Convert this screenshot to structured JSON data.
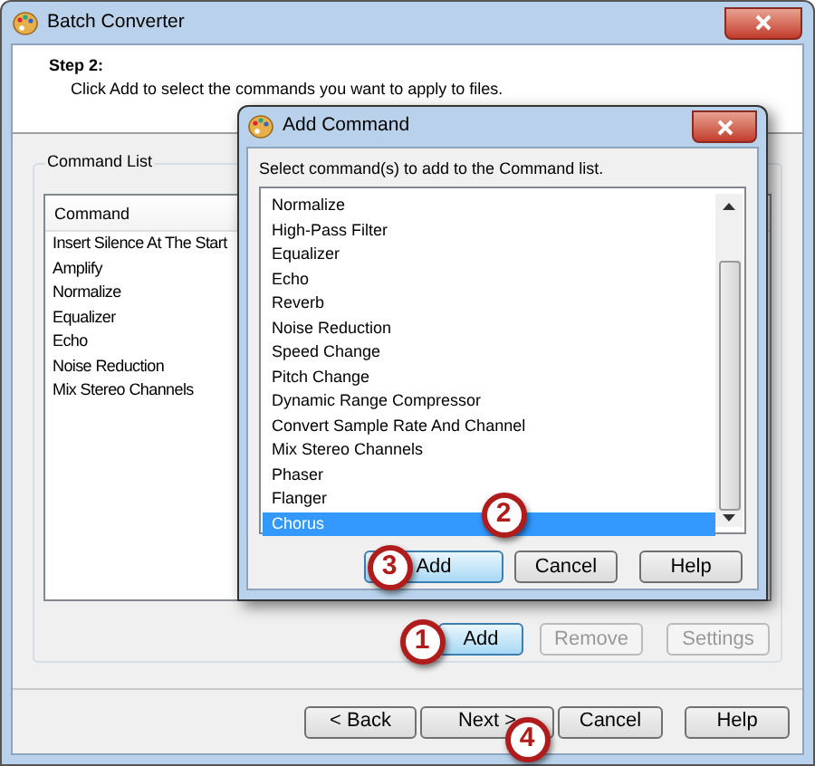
{
  "window": {
    "title": "Batch Converter"
  },
  "step": {
    "heading": "Step 2:",
    "text": "Click Add to select the commands you want to apply to files."
  },
  "command_list": {
    "label": "Command List",
    "column": "Command",
    "rows": [
      "Insert Silence At The Start",
      "Amplify",
      "Normalize",
      "Equalizer",
      "Echo",
      "Noise Reduction",
      "Mix Stereo Channels"
    ],
    "buttons": [
      {
        "label": "Add",
        "disabled": false,
        "highlighted": true
      },
      {
        "label": "Remove",
        "disabled": true,
        "highlighted": false
      },
      {
        "label": "Settings",
        "disabled": true,
        "highlighted": false
      }
    ]
  },
  "wizard_buttons": [
    {
      "label": "< Back"
    },
    {
      "label": "Next >"
    },
    {
      "label": "Cancel"
    },
    {
      "label": "Help"
    }
  ],
  "dialog": {
    "title": "Add Command",
    "instruction": "Select command(s) to add to the Command list.",
    "items": [
      {
        "label": "Normalize",
        "selected": false
      },
      {
        "label": "High-Pass Filter",
        "selected": false
      },
      {
        "label": "Equalizer",
        "selected": false
      },
      {
        "label": "Echo",
        "selected": false
      },
      {
        "label": "Reverb",
        "selected": false
      },
      {
        "label": "Noise Reduction",
        "selected": false
      },
      {
        "label": "Speed Change",
        "selected": false
      },
      {
        "label": "Pitch Change",
        "selected": false
      },
      {
        "label": "Dynamic Range Compressor",
        "selected": false
      },
      {
        "label": "Convert Sample Rate And Channel",
        "selected": false
      },
      {
        "label": "Mix Stereo Channels",
        "selected": false
      },
      {
        "label": "Phaser",
        "selected": false
      },
      {
        "label": "Flanger",
        "selected": false
      },
      {
        "label": "Chorus",
        "selected": true
      }
    ],
    "buttons": [
      {
        "label": "Add",
        "highlighted": true
      },
      {
        "label": "Cancel",
        "highlighted": false
      },
      {
        "label": "Help",
        "highlighted": false
      }
    ]
  },
  "callouts": [
    {
      "label": "1"
    },
    {
      "label": "2"
    },
    {
      "label": "3"
    },
    {
      "label": "4"
    }
  ]
}
